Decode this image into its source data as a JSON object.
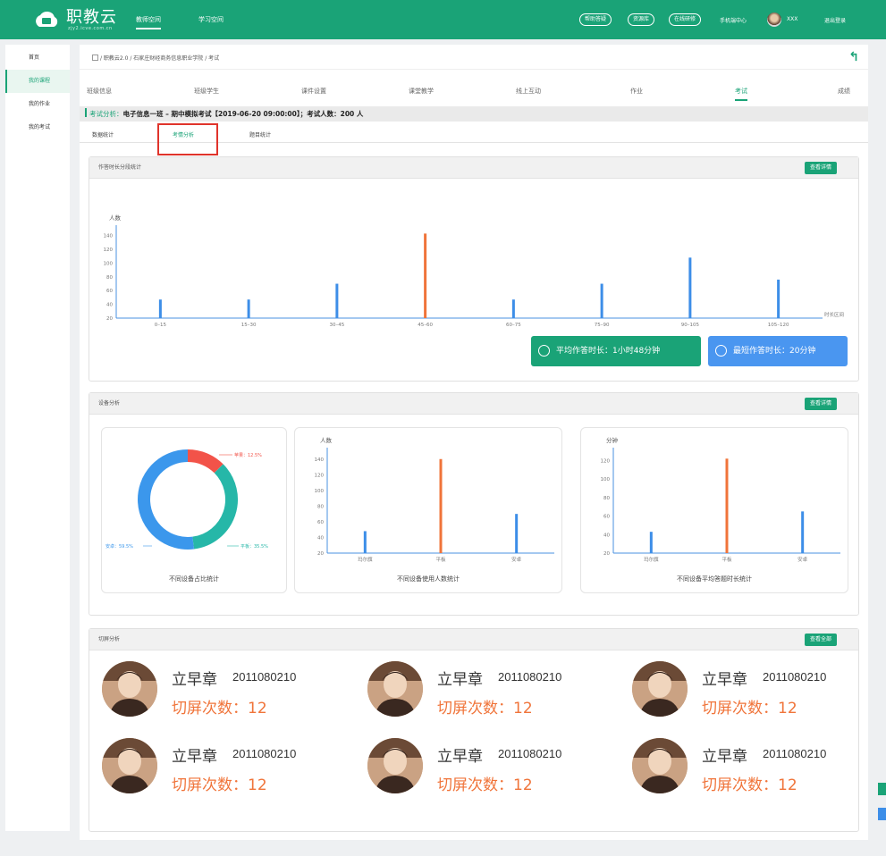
{
  "header": {
    "brand": "职教云",
    "brand_sub": "zjy2.icve.com.cn",
    "nav": [
      "教师空间",
      "学习空间"
    ],
    "pills": [
      "帮助答疑",
      "资源库",
      "在线研修"
    ],
    "items": [
      "手机端中心",
      "XXX",
      "退出登录"
    ]
  },
  "sidebar": {
    "items": [
      "首页",
      "我的课程",
      "我的作业",
      "我的考试"
    ],
    "active_index": 1
  },
  "breadcrumb": "/ 职教云2.0 / 石家庄财经商务信息职业学院 / 考试",
  "tabs": [
    "班级信息",
    "班级学生",
    "课件设置",
    "课堂教学",
    "线上互动",
    "作业",
    "考试",
    "成绩"
  ],
  "active_tab_index": 6,
  "exam_info": {
    "label": "考试分析：",
    "text": "电子信息一班 – 期中模拟考试【2019-06-20 09:00:00】；考试人数：200 人"
  },
  "subtabs": [
    "数据统计",
    "考情分析",
    "题目统计"
  ],
  "active_subtab_index": 1,
  "panel_duration": {
    "title": "作答时长分段统计",
    "button": "查看详情",
    "avg_label": "平均作答时长：1小时48分钟",
    "min_label": "最短作答时长：20分钟"
  },
  "panel_device": {
    "title": "设备分析",
    "button": "查看详情",
    "donut_title": "不同设备占比统计",
    "users_title": "不同设备使用人数统计",
    "time_title": "不同设备平均答题时长统计"
  },
  "panel_cut": {
    "title": "切屏分析",
    "button": "查看全部",
    "items": [
      {
        "name": "立早章",
        "id": "2011080210",
        "count": "切屏次数：12"
      },
      {
        "name": "立早章",
        "id": "2011080210",
        "count": "切屏次数：12"
      },
      {
        "name": "立早章",
        "id": "2011080210",
        "count": "切屏次数：12"
      },
      {
        "name": "立早章",
        "id": "2011080210",
        "count": "切屏次数：12"
      },
      {
        "name": "立早章",
        "id": "2011080210",
        "count": "切屏次数：12"
      },
      {
        "name": "立早章",
        "id": "2011080210",
        "count": "切屏次数：12"
      }
    ]
  },
  "colors": {
    "brand": "#1aa377",
    "bar_blue": "#3d8ee8",
    "bar_orange": "#f0743a",
    "highlight_red": "#e0342b",
    "donut_red": "#f25349",
    "donut_teal": "#26b7a8",
    "donut_blue": "#3b97ec"
  },
  "chart_data": [
    {
      "type": "bar",
      "title": "作答时长分段统计",
      "ylabel": "人数",
      "xlabel": "时长区间",
      "ylim": [
        20,
        150
      ],
      "yticks": [
        20,
        40,
        60,
        80,
        100,
        120,
        140
      ],
      "categories": [
        "0–15",
        "15–30",
        "30–45",
        "45–60",
        "60–75",
        "75–90",
        "90–105",
        "105–120"
      ],
      "values": [
        47,
        47,
        70,
        143,
        47,
        70,
        108,
        76
      ],
      "highlight_index": 3
    },
    {
      "type": "pie",
      "title": "不同设备占比统计",
      "slices": [
        {
          "label": "苹果：12.5%",
          "value": 12.5
        },
        {
          "label": "平板：35.5%",
          "value": 35.5
        },
        {
          "label": "安卓：59.5%",
          "value": 52
        }
      ]
    },
    {
      "type": "bar",
      "title": "不同设备使用人数统计",
      "ylabel": "人数",
      "ylim": [
        20,
        150
      ],
      "yticks": [
        20,
        40,
        60,
        80,
        100,
        120,
        140
      ],
      "categories": [
        "玛尔旗",
        "平板",
        "安卓"
      ],
      "values": [
        48,
        140,
        70
      ],
      "highlight_index": 1
    },
    {
      "type": "bar",
      "title": "不同设备平均答题时长统计",
      "ylabel": "分钟",
      "ylim": [
        20,
        130
      ],
      "yticks": [
        20,
        40,
        60,
        80,
        100,
        120
      ],
      "categories": [
        "玛尔旗",
        "平板",
        "安卓"
      ],
      "values": [
        43,
        122,
        65
      ],
      "highlight_index": 1
    }
  ]
}
